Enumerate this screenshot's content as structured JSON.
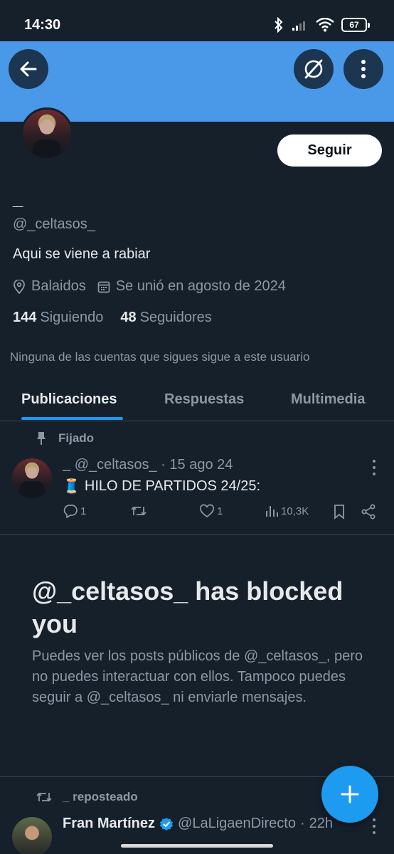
{
  "status_bar": {
    "time": "14:30",
    "battery": "67"
  },
  "profile": {
    "follow_label": "Seguir",
    "display_name": "_",
    "handle": "@_celtasos_",
    "bio": "Aqui se viene a rabiar",
    "location": "Balaidos",
    "joined": "Se unió en agosto de 2024",
    "following_count": "144",
    "following_label": "Siguiendo",
    "followers_count": "48",
    "followers_label": "Seguidores",
    "no_mutual": "Ninguna de las cuentas que sigues sigue a este usuario"
  },
  "tabs": [
    "Publicaciones",
    "Respuestas",
    "Multimedia"
  ],
  "pinned_post": {
    "pinned_label": "Fijado",
    "name": "_",
    "handle": "@_celtasos_",
    "date": "15 ago 24",
    "emoji": "🧵",
    "text": "HILO DE PARTIDOS 24/25:",
    "replies": "1",
    "likes": "1",
    "views": "10,3K"
  },
  "blocked": {
    "title": "@_celtasos_ has blocked you",
    "description": "Puedes ver los posts públicos de @_celtasos_, pero no puedes interactuar con ellos. Tampoco puedes seguir a @_celtasos_ ni enviarle mensajes."
  },
  "repost": {
    "label": "_ reposteado",
    "name": "Fran Martínez",
    "handle": "@LaLigaenDirecto",
    "time": "22h"
  },
  "colors": {
    "banner": "#4a99e9",
    "accent": "#1d9bf0",
    "background": "#15202b"
  },
  "icons": [
    "back-arrow-icon",
    "grok-icon",
    "more-vertical-icon",
    "location-icon",
    "calendar-icon",
    "pin-icon",
    "reply-icon",
    "repost-icon",
    "like-icon",
    "views-icon",
    "bookmark-icon",
    "share-icon",
    "verified-icon",
    "plus-icon"
  ]
}
